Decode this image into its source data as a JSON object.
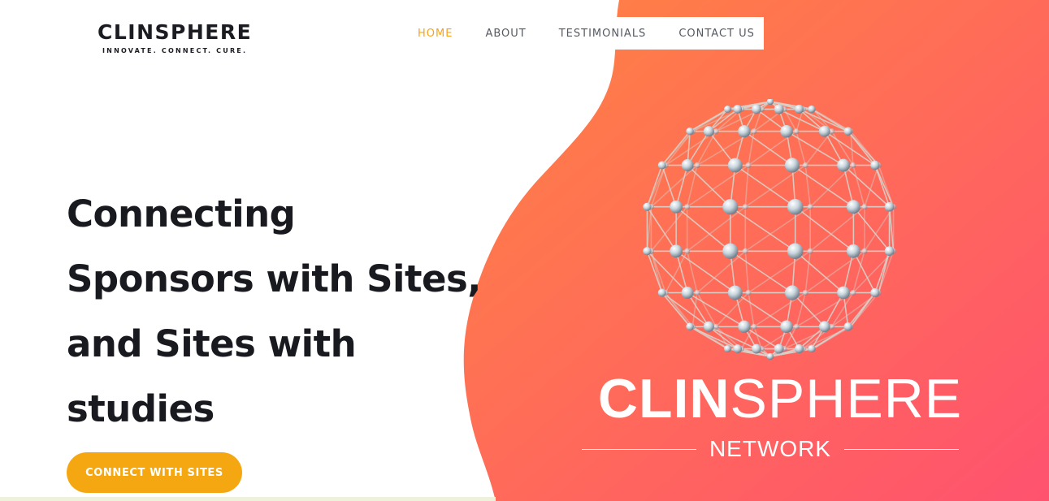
{
  "logo": {
    "title": "CLINSPHERE",
    "tagline": "INNOVATE. CONNECT. CURE."
  },
  "nav": {
    "items": [
      {
        "label": "HOME",
        "active": true
      },
      {
        "label": "ABOUT",
        "active": false
      },
      {
        "label": "TESTIMONIALS",
        "active": false
      },
      {
        "label": "CONTACT US",
        "active": false
      }
    ]
  },
  "hero": {
    "headline_lines": [
      "Connecting",
      "Sponsors with Sites,",
      "and Sites with",
      "studies"
    ],
    "cta_label": "CONNECT WITH SITES"
  },
  "brand_image": {
    "title_bold": "CLIN",
    "title_light": "SPHERE",
    "subtitle": "NETWORK",
    "icon": "network-sphere-icon"
  },
  "colors": {
    "accent": "#f5a712",
    "gradient_start": "#ff7c45",
    "gradient_end": "#ff5470",
    "text_dark": "#191a1f"
  }
}
